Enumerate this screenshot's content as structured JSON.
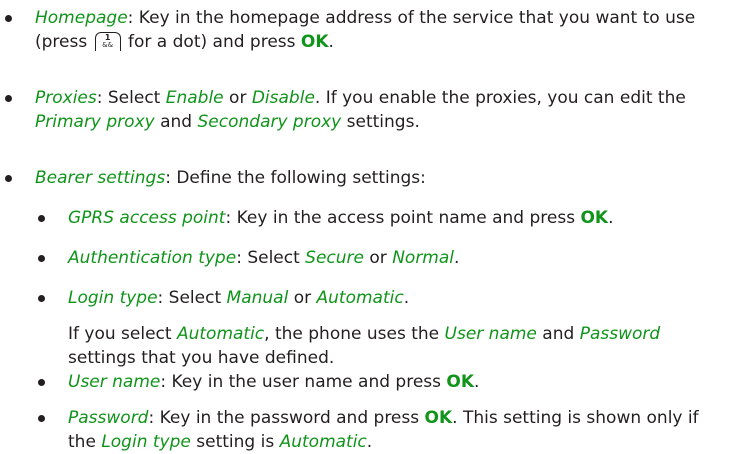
{
  "items": [
    {
      "term": "Homepage",
      "text1": ": Key in the homepage address of the service that you want to use (press ",
      "key_top": "1",
      "key_bottom": "&&",
      "text2": " for a dot) and press ",
      "ok": "OK",
      "text3": "."
    },
    {
      "term": "Proxies",
      "text1": ": Select ",
      "opt1": "Enable",
      "text2": " or ",
      "opt2": "Disable",
      "text3": ". If you enable the proxies, you can edit the ",
      "opt3": "Primary proxy",
      "text4": " and ",
      "opt4": "Secondary proxy",
      "text5": " settings."
    },
    {
      "term": "Bearer settings",
      "text1": ": Define the following settings:"
    },
    {
      "term": "GPRS access point",
      "text1": ": Key in the access point name and press ",
      "ok": "OK",
      "text2": "."
    },
    {
      "term": "Authentication type",
      "text1": ": Select ",
      "opt1": "Secure",
      "text2": " or ",
      "opt2": "Normal",
      "text3": "."
    },
    {
      "term": "Login type",
      "text1": ": Select ",
      "opt1": "Manual",
      "text2": " or ",
      "opt2": "Automatic",
      "text3": "."
    },
    {
      "note_text1": "If you select ",
      "note_opt1": "Automatic",
      "note_text2": ", the phone uses the ",
      "note_opt2": "User name",
      "note_text3": " and ",
      "note_opt3": "Password",
      "note_text4": " settings that you have defined."
    },
    {
      "term": "User name",
      "text1": ": Key in the user name and press ",
      "ok": "OK",
      "text2": "."
    },
    {
      "term": "Password",
      "text1": ": Key in the password and press ",
      "ok": "OK",
      "text2": ". This setting is shown only if the ",
      "opt1": "Login type",
      "text3": " setting is ",
      "opt2": "Automatic",
      "text4": "."
    }
  ]
}
